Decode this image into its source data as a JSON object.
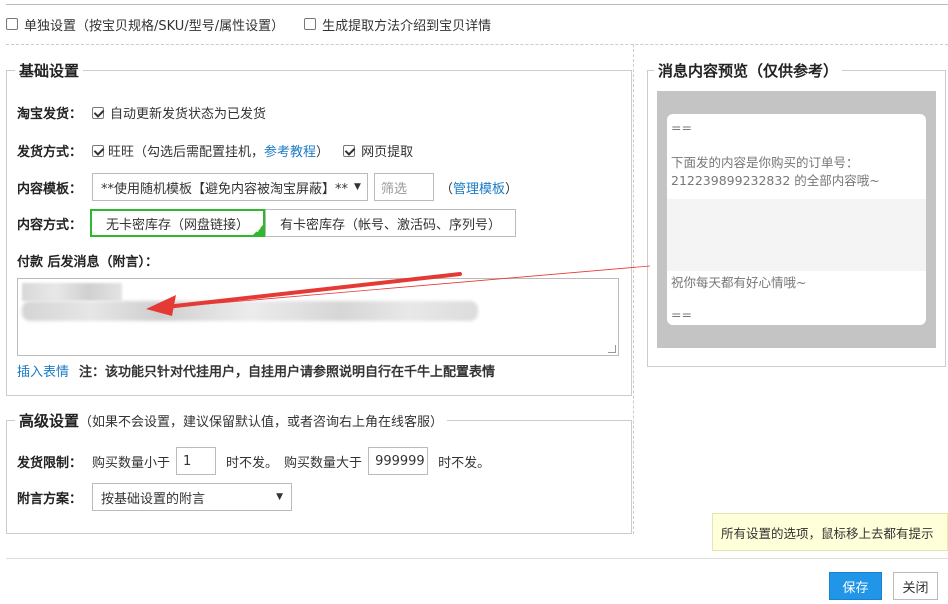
{
  "top_options": {
    "individual_settings": "单独设置（按宝贝规格/SKU/型号/属性设置）",
    "generate_intro": "生成提取方法介绍到宝贝详情"
  },
  "basic": {
    "legend": "基础设置",
    "taobao_ship_label": "淘宝发货：",
    "auto_update_status": "自动更新发货状态为已发货",
    "ship_method_label": "发货方式：",
    "wangwang": "旺旺（勾选后需配置挂机，",
    "ref_tutorial": "参考教程",
    "wangwang_close": "）",
    "web_extract": "网页提取",
    "template_label": "内容模板：",
    "template_value": "**使用随机模板【避免内容被淘宝屏蔽】**",
    "filter_placeholder": "筛选",
    "manage_open": "（",
    "manage_template": "管理模板",
    "manage_close": "）",
    "content_mode_label": "内容方式：",
    "mode_no_card": "无卡密库存（网盘链接）",
    "mode_card": "有卡密库存（帐号、激活码、序列号）",
    "after_pay_label": "付款 后发消息（附言）：",
    "insert_emoji": "插入表情",
    "note_prefix": "注：该功能只针对代挂用户，自挂用户请",
    "note_link": "参照说明",
    "note_suffix": "自行在千牛上配置表情"
  },
  "advanced": {
    "legend": "高级设置",
    "legend_hint": "（如果不会设置，建议保留默认值，或者咨询右上角在线客服）",
    "ship_limit_label": "发货限制：",
    "qty_less_prefix": "购买数量小于",
    "qty_less_value": "1",
    "qty_less_suffix": "时不发。",
    "qty_more_prefix": "购买数量大于",
    "qty_more_value": "999999",
    "qty_more_suffix": "时不发。",
    "note_plan_label": "附言方案：",
    "note_plan_value": "按基础设置的附言"
  },
  "preview": {
    "legend": "消息内容预览（仅供参考）",
    "line1": "==",
    "line2": "下面发的内容是你购买的订单号：",
    "line3": "212239899232832 的全部内容哦~",
    "line4": "祝你每天都有好心情哦~",
    "line5": "=="
  },
  "tooltip": "所有设置的选项，鼠标移上去都有提示",
  "buttons": {
    "save": "保存",
    "close": "关闭"
  },
  "colors": {
    "accent_blue": "#2196e8",
    "link_blue": "#1a7bc4",
    "active_green": "#2eb82e",
    "arrow_red": "#e53935"
  }
}
